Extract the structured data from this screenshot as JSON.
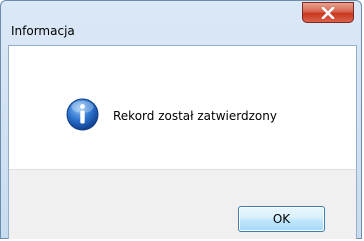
{
  "dialog": {
    "title": "Informacja",
    "message": "Rekord został zatwierdzony",
    "icon": "information-icon",
    "close_icon": "close-icon",
    "ok_label": "OK"
  },
  "colors": {
    "title_gradient_top": "#dbe8f6",
    "close_button_red": "#c7381f",
    "footer_background": "#f0f0f0",
    "ok_button_border": "#3c7fb1",
    "info_icon_blue": "#1d5fb8"
  }
}
